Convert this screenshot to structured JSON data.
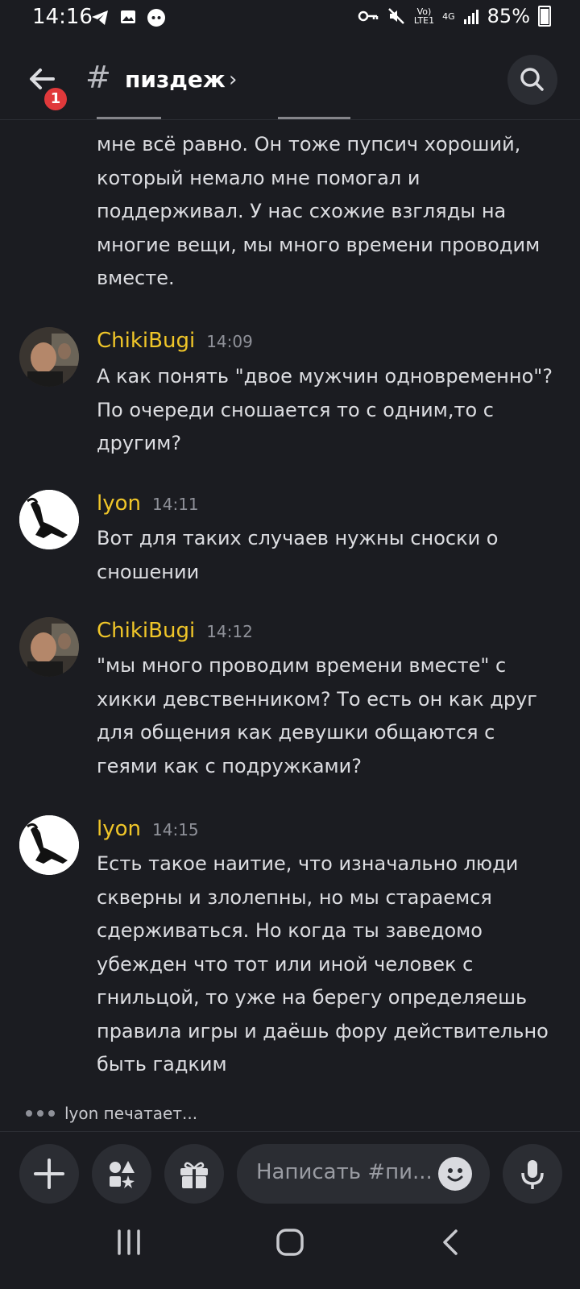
{
  "status_bar": {
    "time": "14:16",
    "network_top": "Vo)",
    "network_bottom": "LTE1",
    "gen": "4G",
    "battery": "85%"
  },
  "header": {
    "notification_count": "1",
    "channel_hash": "#",
    "channel_name": "пиздеж",
    "chevron": "›"
  },
  "messages": [
    {
      "continuation_text": "мне всё равно. Он тоже пупсич хороший, который немало мне помогал и поддерживал. У нас схожие взгляды на многие вещи, мы много времени проводим вместе."
    },
    {
      "author": "ChikiBugi",
      "time": "14:09",
      "text": "А как понять \"двое мужчин одновременно\"? По очереди сношается то с одним,то с другим?"
    },
    {
      "author": "lyon",
      "time": "14:11",
      "text": "Вот для таких случаев нужны сноски о сношении"
    },
    {
      "author": "ChikiBugi",
      "time": "14:12",
      "text": "\"мы много проводим времени вместе\" с хикки девственником? То есть он как друг для общения как девушки общаются с геями как с подружками?"
    },
    {
      "author": "lyon",
      "time": "14:15",
      "text": "Есть такое наитие, что изначально люди скверны и злолепны, но мы стараемся сдерживаться. Но когда ты заведомо убежден что тот или иной человек с гнильцой, то уже на берегу определяешь правила игры и даёшь фору действительно быть гадким"
    }
  ],
  "typing": {
    "user": "lyon",
    "label": "печатает..."
  },
  "composer": {
    "placeholder": "Написать #пи..."
  },
  "colors": {
    "background": "#1b1c21",
    "username": "#f0c629",
    "badge": "#e0393b"
  }
}
